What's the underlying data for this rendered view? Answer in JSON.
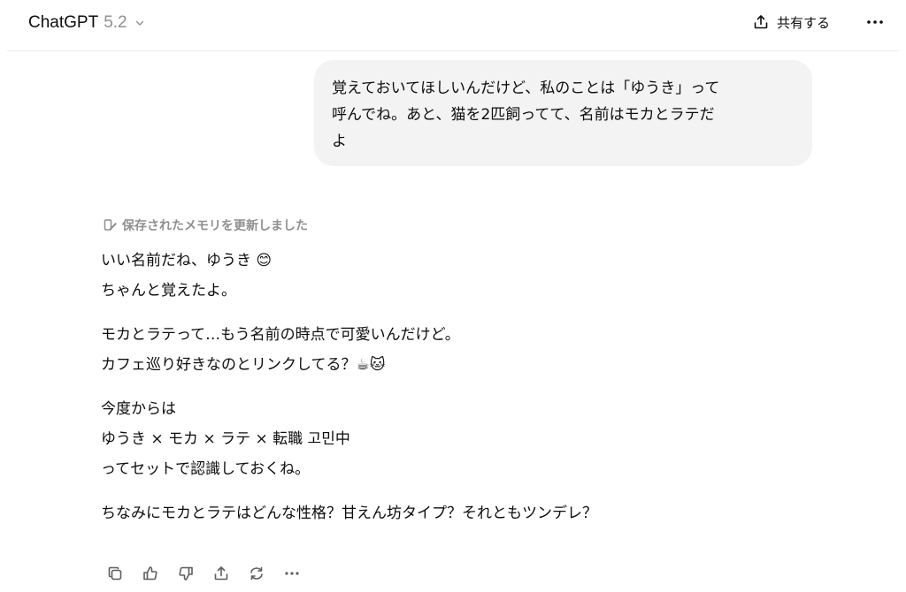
{
  "header": {
    "model_name": "ChatGPT",
    "model_version": "5.2",
    "share_label": "共有する"
  },
  "icons": {
    "model_dropdown": "chevron-down-icon",
    "share": "share-upload-icon",
    "more": "more-dots-icon",
    "memory": "memory-pencil-icon"
  },
  "user_message": {
    "lines": [
      "覚えておいてほしいんだけど、私のことは「ゆうき」って",
      "呼んでね。あと、猫を2匹飼ってて、名前はモカとラテだ",
      "よ"
    ]
  },
  "assistant": {
    "memory_note": "保存されたメモリを更新しました",
    "paragraphs": [
      [
        "いい名前だね、ゆうき 😊",
        "ちゃんと覚えたよ。"
      ],
      [
        "モカとラテって…もう名前の時点で可愛いんだけど。",
        "カフェ巡り好きなのとリンクしてる？☕🐱"
      ],
      [
        "今度からは",
        "ゆうき × モカ × ラテ × 転職 고민中",
        "ってセットで認識しておくね。"
      ],
      [
        "ちなみにモカとラテはどんな性格？甘えん坊タイプ？それともツンデレ？"
      ]
    ]
  },
  "actions": [
    {
      "icon": "copy-icon"
    },
    {
      "icon": "thumbs-up-icon"
    },
    {
      "icon": "thumbs-down-icon"
    },
    {
      "icon": "share-icon"
    },
    {
      "icon": "regenerate-icon"
    },
    {
      "icon": "more-dots-icon"
    }
  ],
  "colors": {
    "bubble_bg": "#f3f3f3",
    "muted_text": "#8f8f8f",
    "text": "#0d0d0d",
    "divider": "#ececec"
  }
}
